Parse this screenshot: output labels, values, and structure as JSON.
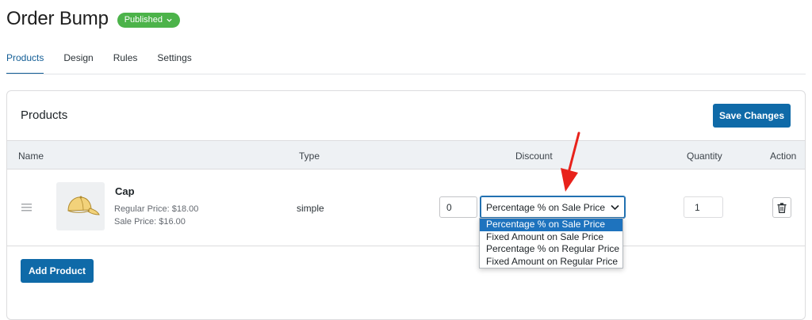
{
  "page": {
    "title": "Order Bump",
    "status_badge": "Published"
  },
  "tabs": [
    {
      "label": "Products",
      "active": true
    },
    {
      "label": "Design",
      "active": false
    },
    {
      "label": "Rules",
      "active": false
    },
    {
      "label": "Settings",
      "active": false
    }
  ],
  "products_card": {
    "title": "Products",
    "save_label": "Save Changes",
    "add_label": "Add Product",
    "columns": {
      "name": "Name",
      "type": "Type",
      "discount": "Discount",
      "quantity": "Quantity",
      "action": "Action"
    },
    "rows": [
      {
        "name": "Cap",
        "regular_price": "Regular Price: $18.00",
        "sale_price": "Sale Price: $16.00",
        "type": "simple",
        "discount_value": "0",
        "discount_type": "Percentage % on Sale Price",
        "quantity": "1"
      }
    ]
  },
  "discount_dropdown": {
    "options": [
      "Percentage % on Sale Price",
      "Fixed Amount on Sale Price",
      "Percentage % on Regular Price",
      "Fixed Amount on Regular Price"
    ],
    "selected": "Percentage % on Sale Price"
  },
  "colors": {
    "accent": "#0f6aa8",
    "badge": "#4cb34a",
    "annotation_arrow": "#e8221b"
  },
  "icons": {
    "drag": "drag-handle-icon",
    "trash": "trash-icon",
    "chevron": "chevron-down-icon",
    "thumbnail": "cap-thumbnail"
  }
}
